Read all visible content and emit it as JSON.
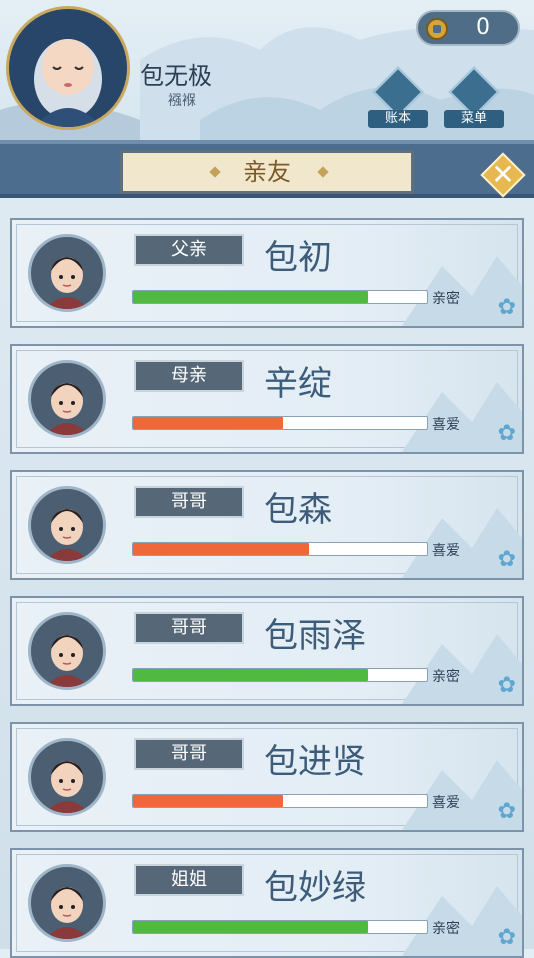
{
  "player": {
    "name": "包无极",
    "stage": "襁褓"
  },
  "currency": {
    "coins": "0"
  },
  "header_buttons": [
    {
      "label": "账本",
      "icon": "ledger-icon"
    },
    {
      "label": "菜单",
      "icon": "menu-dots-icon"
    }
  ],
  "page": {
    "title": "亲友"
  },
  "colors": {
    "bar_green": "#4fba3f",
    "bar_orange": "#f0683a",
    "banner": "#4d6d8f",
    "accent_gold": "#e7b750"
  },
  "relatives": [
    {
      "relation": "父亲",
      "name": "包初",
      "level_label": "亲密",
      "affinity": 0.8,
      "bar_color": "green"
    },
    {
      "relation": "母亲",
      "name": "辛绽",
      "level_label": "喜爱",
      "affinity": 0.51,
      "bar_color": "orange"
    },
    {
      "relation": "哥哥",
      "name": "包森",
      "level_label": "喜爱",
      "affinity": 0.6,
      "bar_color": "orange"
    },
    {
      "relation": "哥哥",
      "name": "包雨泽",
      "level_label": "亲密",
      "affinity": 0.8,
      "bar_color": "green"
    },
    {
      "relation": "哥哥",
      "name": "包进贤",
      "level_label": "喜爱",
      "affinity": 0.51,
      "bar_color": "orange"
    },
    {
      "relation": "姐姐",
      "name": "包妙绿",
      "level_label": "亲密",
      "affinity": 0.8,
      "bar_color": "green"
    }
  ]
}
